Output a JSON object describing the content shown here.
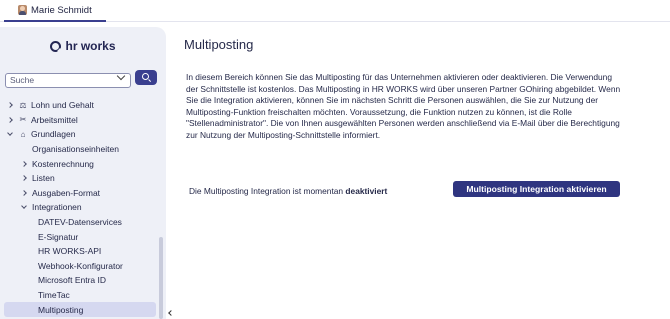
{
  "header": {
    "user_name": "Marie Schmidt"
  },
  "sidebar": {
    "logo_text": "hr works",
    "search": {
      "placeholder": "Suche"
    },
    "items": [
      {
        "label": "Lohn und Gehalt",
        "level": 0,
        "caret": "right",
        "icon": "payroll-icon"
      },
      {
        "label": "Arbeitsmittel",
        "level": 0,
        "caret": "right",
        "icon": "tools-icon"
      },
      {
        "label": "Grundlagen",
        "level": 0,
        "caret": "down",
        "icon": "home-icon"
      },
      {
        "label": "Organisationseinheiten",
        "level": 1,
        "caret": "none"
      },
      {
        "label": "Kostenrechnung",
        "level": 1,
        "caret": "right"
      },
      {
        "label": "Listen",
        "level": 1,
        "caret": "right"
      },
      {
        "label": "Ausgaben-Format",
        "level": 1,
        "caret": "right"
      },
      {
        "label": "Integrationen",
        "level": 1,
        "caret": "down"
      },
      {
        "label": "DATEV-Datenservices",
        "level": 2,
        "caret": "none"
      },
      {
        "label": "E-Signatur",
        "level": 2,
        "caret": "none"
      },
      {
        "label": "HR WORKS-API",
        "level": 2,
        "caret": "none"
      },
      {
        "label": "Webhook-Konfigurator",
        "level": 2,
        "caret": "none"
      },
      {
        "label": "Microsoft Entra ID",
        "level": 2,
        "caret": "none"
      },
      {
        "label": "TimeTac",
        "level": 2,
        "caret": "none"
      },
      {
        "label": "Multiposting",
        "level": 2,
        "caret": "none",
        "active": true
      }
    ]
  },
  "main": {
    "title": "Multiposting",
    "description": "In diesem Bereich können Sie das Multiposting für das Unternehmen aktivieren oder deaktivieren. Die Verwendung der Schnittstelle ist kostenlos. Das Multiposting in HR WORKS wird über unseren Partner GOhiring abgebildet. Wenn Sie die Integration aktivieren, können Sie im nächsten Schritt die Personen auswählen, die Sie zur Nutzung der Multiposting-Funktion freischalten möchten. Voraussetzung, die Funktion nutzen zu können, ist die Rolle \"Stellenadministrator\". Die von Ihnen ausgewählten Personen werden anschließend via E-Mail über die Berechtigung zur Nutzung der Multiposting-Schnittstelle informiert.",
    "status_prefix": "Die Multiposting Integration ist momentan ",
    "status_value": "deaktiviert",
    "activate_button": "Multiposting Integration aktivieren"
  },
  "colors": {
    "accent": "#2f3580",
    "sidebar_bg": "#eef0f7",
    "active_item_bg": "#d5d8f0"
  }
}
